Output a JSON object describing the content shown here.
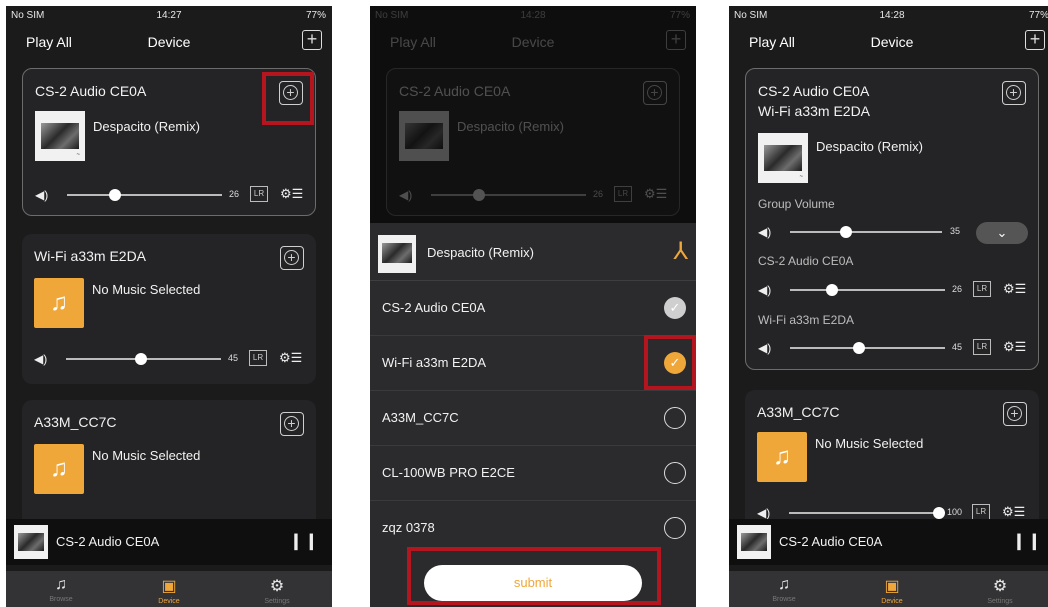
{
  "status": {
    "carrier": "No SIM",
    "battery": "77%",
    "times": [
      "14:27",
      "14:28",
      "14:28"
    ]
  },
  "nav": {
    "play_all": "Play All",
    "title": "Device"
  },
  "devices": {
    "cs2": "CS-2 Audio CE0A",
    "wifi": "Wi-Fi a33m E2DA",
    "a33m": "A33M_CC7C",
    "cl100": "CL-100WB PRO E2CE",
    "zqz": "zqz 0378"
  },
  "track": {
    "despacito": "Despacito (Remix)",
    "none": "No Music Selected"
  },
  "volumes": {
    "cs2": "26",
    "wifi": "45",
    "group": "35",
    "a33m": "100"
  },
  "volume_levels": {
    "cs2": 0.27,
    "wifi": 0.46,
    "group": 0.36,
    "a33m": 1.0
  },
  "labels": {
    "lr": "LR",
    "group_volume": "Group Volume",
    "submit": "submit"
  },
  "tabs": {
    "browse": "Browse",
    "device": "Device",
    "settings": "Settings"
  },
  "colors": {
    "accent": "#f0a73a",
    "highlight": "#b5151f"
  },
  "icons": [
    "speaker-icon",
    "equalizer-icon",
    "music-note-icon",
    "pause-icon",
    "checkmark-icon",
    "group-add-icon"
  ]
}
